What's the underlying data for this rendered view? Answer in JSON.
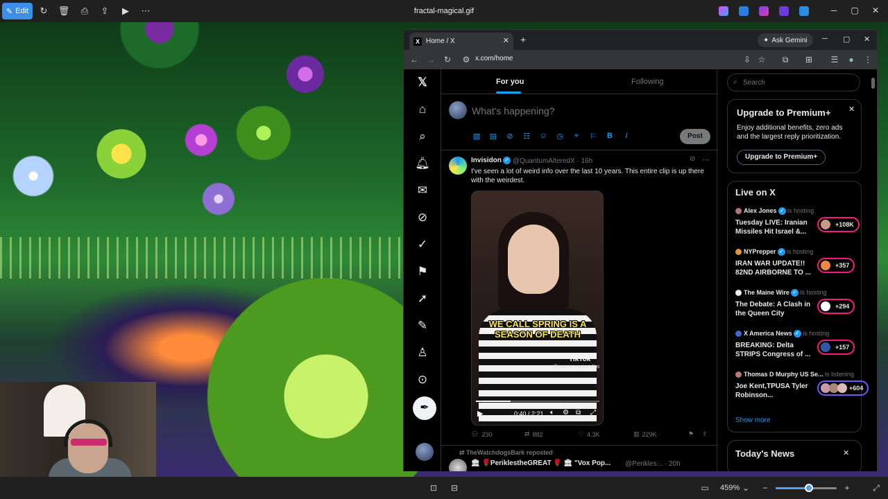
{
  "viewer": {
    "edit_label": "Edit",
    "file_title": "fractal-magical.gif",
    "zoom_text": "459%",
    "zoom_fraction": 0.55
  },
  "browser": {
    "tab_title": "Home / X",
    "ask_gemini": "Ask Gemini",
    "url": "x.com/home"
  },
  "x": {
    "tabs": [
      "For you",
      "Following"
    ],
    "composer_placeholder": "What's happening?",
    "post_label": "Post",
    "tweet": {
      "name": "Invisidon",
      "handle_time": "@QuantumAlteredX · 16h",
      "text": "I've seen a lot of weird info over the last 10 years.  This entire clip is up there with the weirdest.",
      "video_caption": "WE CALL SPRING IS A SEASON OF DEATH",
      "tiktok": "TikTok",
      "tiktok_user": "@ryanmemories.clips",
      "video_time": "0:40 / 2:21",
      "video_progress": 0.28,
      "replies": "230",
      "reposts": "882",
      "likes": "4.3K",
      "views": "229K"
    },
    "repost": {
      "label": "TheWatchdogsBark reposted",
      "name": "🏛 🌹PeriklestheGREAT 🌹 🏛 \"Vox Pop...",
      "handle_time": "@Perikles... · 20h"
    },
    "search_placeholder": "Search",
    "premium": {
      "title": "Upgrade to Premium+",
      "body": "Enjoy additional benefits, zero ads and the largest reply prioritization.",
      "button": "Upgrade to Premium+"
    },
    "live": {
      "title": "Live on X",
      "items": [
        {
          "host": "Alex Jones",
          "status": "is hosting",
          "text": "Tuesday LIVE: Iranian Missiles Hit Israel &...",
          "count": "+108K"
        },
        {
          "host": "NYPrepper",
          "status": "is hosting",
          "text": "IRAN WAR UPDATE!! 82ND AIRBORNE TO ...",
          "count": "+357"
        },
        {
          "host": "The Maine Wire",
          "status": "is hosting",
          "text": "The Debate: A Clash in the Queen City",
          "count": "+294"
        },
        {
          "host": "X America News",
          "status": "is hosting",
          "text": "BREAKING: Delta STRIPS Congress of ...",
          "count": "+157"
        },
        {
          "host": "Thomas D Murphy US Se...",
          "status": "is listening",
          "text": "Joe Kent,TPUSA Tyler Robinson...",
          "count": "+604"
        }
      ],
      "show_more": "Show more"
    },
    "news_title": "Today's News"
  }
}
